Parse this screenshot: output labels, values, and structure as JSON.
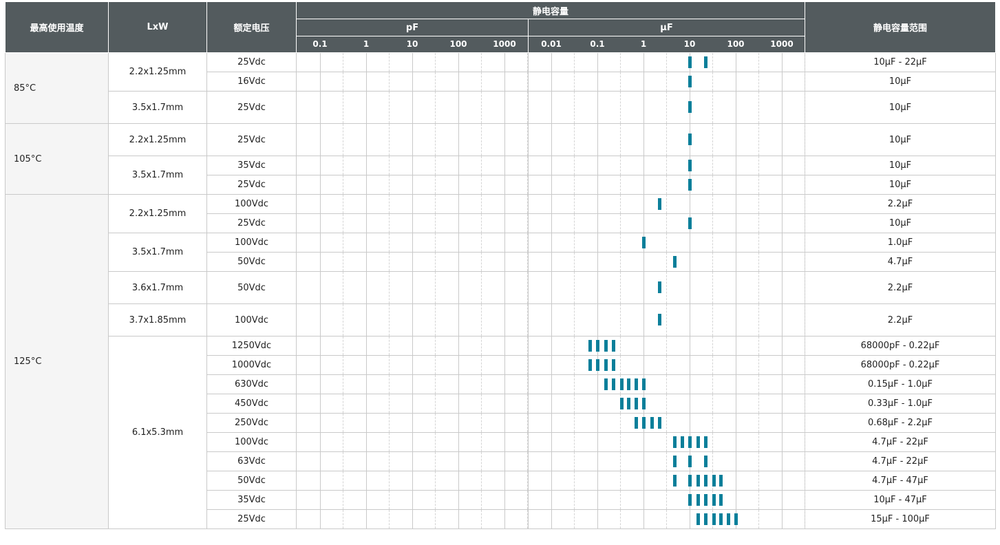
{
  "header": {
    "col_temp": "最高使用温度",
    "col_size": "LxW",
    "col_voltage": "额定电压",
    "col_capacitance": "静电容量",
    "col_range": "静电容量范围",
    "unit_pf": "pF",
    "unit_uf": "μF",
    "pf_ticks": [
      "0.1",
      "1",
      "10",
      "100",
      "1000"
    ],
    "uf_ticks": [
      "0.01",
      "0.1",
      "1",
      "10",
      "100",
      "1000"
    ]
  },
  "temp_groups": [
    {
      "temp": "85°C",
      "sizes": [
        {
          "size": "2.2x1.25mm",
          "rows": [
            {
              "voltage": "25Vdc",
              "range": "10μF - 22μF",
              "caps_uf": [
                10,
                22
              ]
            },
            {
              "voltage": "16Vdc",
              "range": "10μF",
              "caps_uf": [
                10
              ]
            }
          ]
        },
        {
          "size": "3.5x1.7mm",
          "rows": [
            {
              "voltage": "25Vdc",
              "range": "10μF",
              "caps_uf": [
                10
              ]
            }
          ]
        }
      ]
    },
    {
      "temp": "105°C",
      "sizes": [
        {
          "size": "2.2x1.25mm",
          "rows": [
            {
              "voltage": "25Vdc",
              "range": "10μF",
              "caps_uf": [
                10
              ]
            }
          ]
        },
        {
          "size": "3.5x1.7mm",
          "rows": [
            {
              "voltage": "35Vdc",
              "range": "10μF",
              "caps_uf": [
                10
              ]
            },
            {
              "voltage": "25Vdc",
              "range": "10μF",
              "caps_uf": [
                10
              ]
            }
          ]
        }
      ]
    },
    {
      "temp": "125°C",
      "sizes": [
        {
          "size": "2.2x1.25mm",
          "rows": [
            {
              "voltage": "100Vdc",
              "range": "2.2μF",
              "caps_uf": [
                2.2
              ]
            },
            {
              "voltage": "25Vdc",
              "range": "10μF",
              "caps_uf": [
                10
              ]
            }
          ]
        },
        {
          "size": "3.5x1.7mm",
          "rows": [
            {
              "voltage": "100Vdc",
              "range": "1.0μF",
              "caps_uf": [
                1.0
              ]
            },
            {
              "voltage": "50Vdc",
              "range": "4.7μF",
              "caps_uf": [
                4.7
              ]
            }
          ]
        },
        {
          "size": "3.6x1.7mm",
          "rows": [
            {
              "voltage": "50Vdc",
              "range": "2.2μF",
              "caps_uf": [
                2.2
              ]
            }
          ]
        },
        {
          "size": "3.7x1.85mm",
          "rows": [
            {
              "voltage": "100Vdc",
              "range": "2.2μF",
              "caps_uf": [
                2.2
              ]
            }
          ]
        },
        {
          "size": "6.1x5.3mm",
          "rows": [
            {
              "voltage": "1250Vdc",
              "range": "68000pF - 0.22μF",
              "caps_uf": [
                0.068,
                0.1,
                0.15,
                0.22
              ]
            },
            {
              "voltage": "1000Vdc",
              "range": "68000pF - 0.22μF",
              "caps_uf": [
                0.068,
                0.1,
                0.15,
                0.22
              ]
            },
            {
              "voltage": "630Vdc",
              "range": "0.15μF - 1.0μF",
              "caps_uf": [
                0.15,
                0.22,
                0.33,
                0.47,
                0.68,
                1.0
              ]
            },
            {
              "voltage": "450Vdc",
              "range": "0.33μF - 1.0μF",
              "caps_uf": [
                0.33,
                0.47,
                0.68,
                1.0
              ]
            },
            {
              "voltage": "250Vdc",
              "range": "0.68μF - 2.2μF",
              "caps_uf": [
                0.68,
                1.0,
                1.5,
                2.2
              ]
            },
            {
              "voltage": "100Vdc",
              "range": "4.7μF - 22μF",
              "caps_uf": [
                4.7,
                6.8,
                10,
                15,
                22
              ]
            },
            {
              "voltage": "63Vdc",
              "range": "4.7μF - 22μF",
              "caps_uf": [
                4.7,
                10,
                22
              ]
            },
            {
              "voltage": "50Vdc",
              "range": "4.7μF - 47μF",
              "caps_uf": [
                4.7,
                10,
                15,
                22,
                33,
                47
              ]
            },
            {
              "voltage": "35Vdc",
              "range": "10μF - 47μF",
              "caps_uf": [
                10,
                15,
                22,
                33,
                47
              ]
            },
            {
              "voltage": "25Vdc",
              "range": "15μF - 100μF",
              "caps_uf": [
                15,
                22,
                33,
                47,
                68,
                100
              ]
            }
          ]
        }
      ]
    }
  ],
  "colors": {
    "header_bg": "#535b5e",
    "mark": "#0a7f9a",
    "temp_bg": "#f5f5f5"
  }
}
